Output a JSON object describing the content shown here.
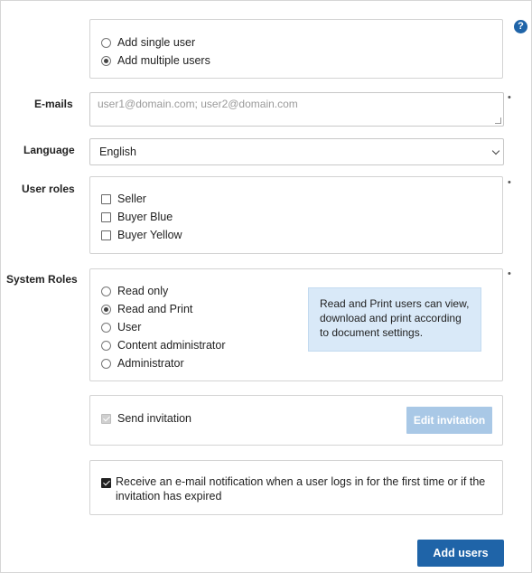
{
  "help": {
    "glyph": "?",
    "icon": "question-circle-icon"
  },
  "mode": {
    "options": [
      {
        "label": "Add single user",
        "selected": false
      },
      {
        "label": "Add multiple users",
        "selected": true
      }
    ]
  },
  "emails": {
    "label": "E-mails",
    "placeholder": "user1@domain.com; user2@domain.com",
    "value": "",
    "required_mark": "•"
  },
  "language": {
    "label": "Language",
    "value": "English"
  },
  "user_roles": {
    "label": "User roles",
    "required_mark": "•",
    "options": [
      {
        "label": "Seller",
        "checked": false
      },
      {
        "label": "Buyer Blue",
        "checked": false
      },
      {
        "label": "Buyer Yellow",
        "checked": false
      }
    ]
  },
  "system_roles": {
    "label": "System Roles",
    "required_mark": "•",
    "options": [
      {
        "label": "Read only",
        "selected": false
      },
      {
        "label": "Read and Print",
        "selected": true
      },
      {
        "label": "User",
        "selected": false
      },
      {
        "label": "Content administrator",
        "selected": false
      },
      {
        "label": "Administrator",
        "selected": false
      }
    ],
    "info": "Read and Print users can view, download and print according to document settings."
  },
  "invitation": {
    "send_label": "Send invitation",
    "send_checked": true,
    "send_disabled": true,
    "edit_button": "Edit invitation"
  },
  "notification": {
    "label": "Receive an e-mail notification when a user logs in for the first time or if the invitation has expired",
    "checked": true
  },
  "submit": {
    "label": "Add users"
  },
  "colors": {
    "primary": "#1f64a8",
    "disabled_button": "#a9c8e6",
    "info_bg": "#d9e9f8",
    "border": "#d3d3d3"
  }
}
